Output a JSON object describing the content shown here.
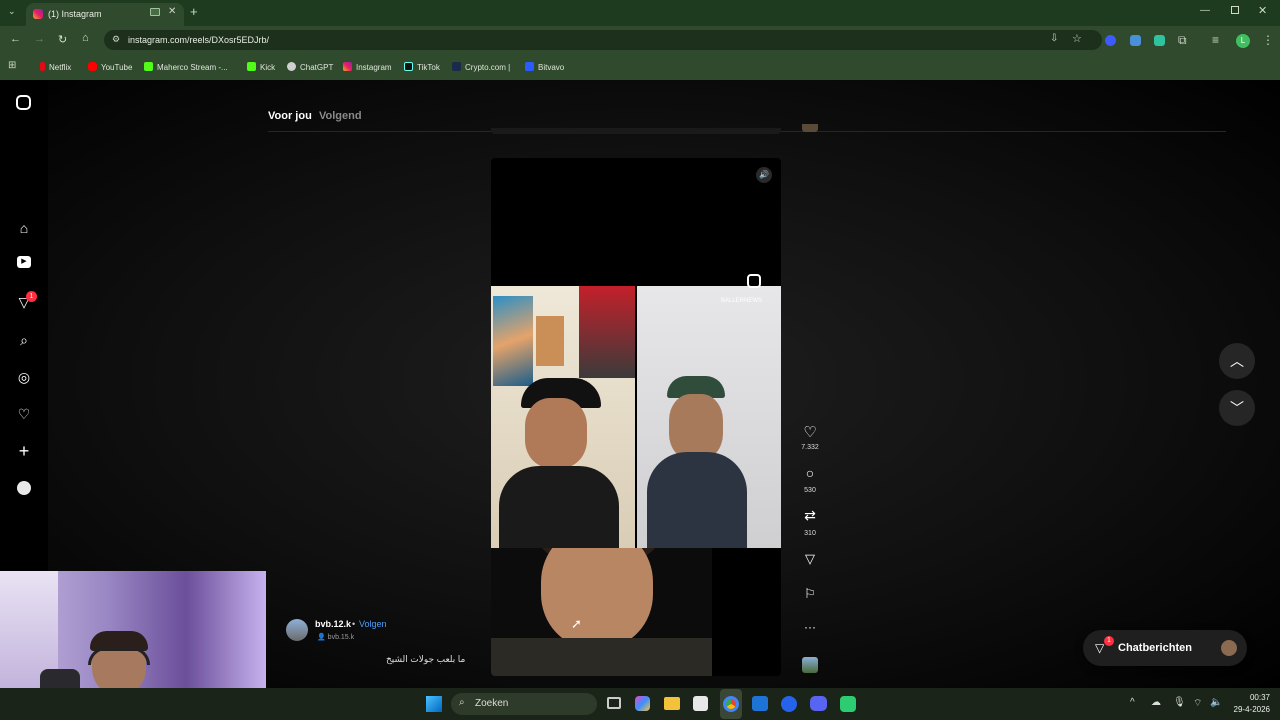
{
  "browser": {
    "tab_title": "(1) Instagram",
    "url": "instagram.com/reels/DXosr5EDJrb/",
    "bookmarks": [
      "Netflix",
      "YouTube",
      "Maherco Stream -...",
      "Kick",
      "ChatGPT",
      "Instagram",
      "TikTok",
      "Crypto.com |",
      "Bitvavo"
    ],
    "profile_initial": "L"
  },
  "reels": {
    "tabs": [
      {
        "label": "Voor jou",
        "active": true
      },
      {
        "label": "Volgend",
        "active": false
      }
    ],
    "stats": {
      "likes": "7.332",
      "comments": "530",
      "reposts": "310"
    },
    "author": {
      "username": "bvb.12.k",
      "follow_label": "Volgen",
      "separator": "•",
      "secondary": "bvb.15.k"
    },
    "caption": "ما بلعب جولات الشيخ",
    "video_watermark": "BALLERNEWS"
  },
  "chat": {
    "label": "Chatberichten",
    "badge": "1"
  },
  "notifications_badge": "1",
  "taskbar": {
    "search_placeholder": "Zoeken",
    "time": "00:37",
    "date": "29-4-2026"
  },
  "colors": {
    "accent_blue": "#4a9eff",
    "badge_red": "#ff3040",
    "chrome_green": "#2f4a2c"
  }
}
